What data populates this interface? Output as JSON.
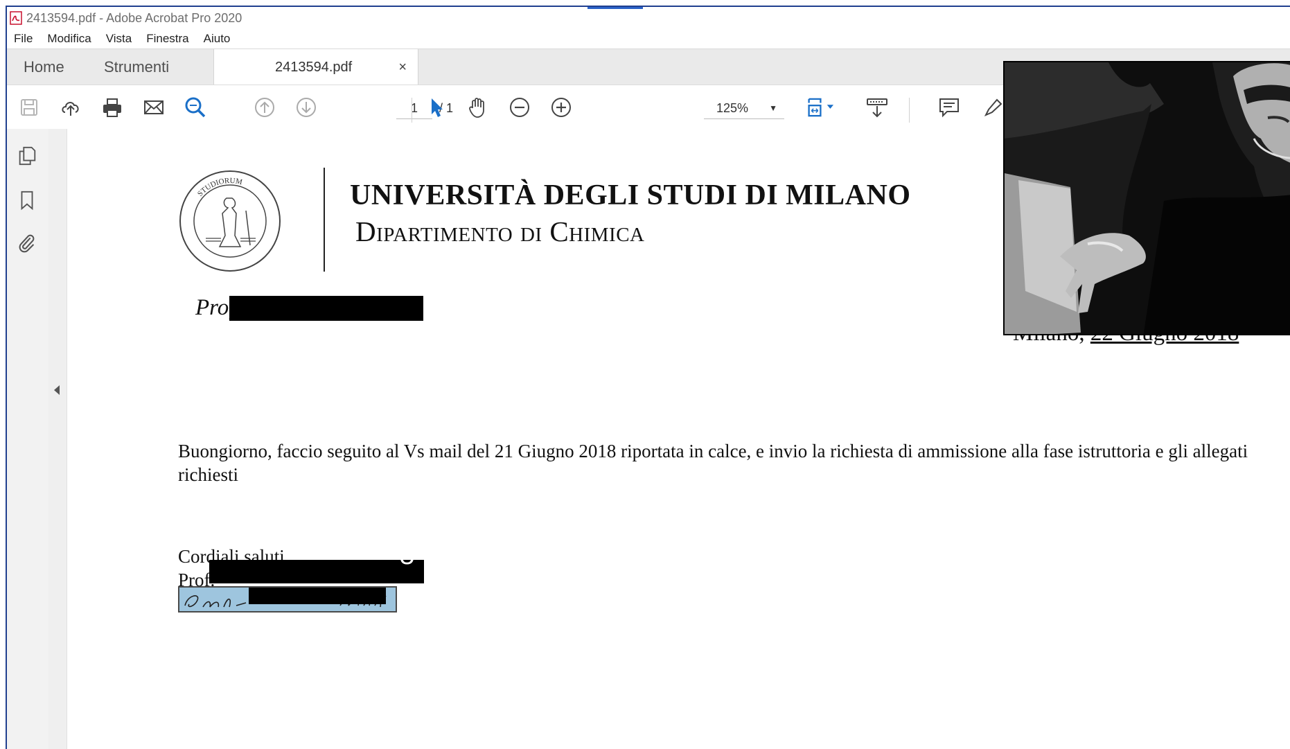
{
  "window": {
    "title": "2413594.pdf - Adobe Acrobat Pro 2020"
  },
  "menu": {
    "items": [
      "File",
      "Modifica",
      "Vista",
      "Finestra",
      "Aiuto"
    ]
  },
  "tabs": {
    "home": "Home",
    "tools": "Strumenti",
    "document": "2413594.pdf",
    "close": "×"
  },
  "toolbar": {
    "page_current": "1",
    "page_total": "/ 1",
    "zoom": "125%",
    "icons": [
      "save-icon",
      "upload-cloud-icon",
      "print-icon",
      "email-icon",
      "search-zoom-icon",
      "prev-page-icon",
      "next-page-icon",
      "select-arrow-icon",
      "hand-icon",
      "zoom-out-icon",
      "zoom-in-icon",
      "fit-page-icon",
      "scroll-mode-icon",
      "comment-icon",
      "highlight-pen-icon"
    ]
  },
  "sidebar": {
    "icons": [
      "pages-icon",
      "bookmark-icon",
      "attachment-icon"
    ]
  },
  "document": {
    "seal_text_top": "STUDIORUM",
    "university": "UNIVERSITÀ DEGLI STUDI DI MILANO",
    "department": "Dipartimento di Chimica",
    "prof_label": "Prof.",
    "date_city": "Milano, ",
    "date_value": "22 Giugno 2018",
    "body": "Buongiorno, faccio seguito al Vs mail del 21 Giugno 2018 riportata in calce, e invio la richiesta di ammissione alla fase istruttoria e gli allegati richiesti",
    "closing": "Cordiali saluti",
    "signature_prof": "Prof.",
    "stray_glyph": "Ù"
  },
  "colors": {
    "accent": "#2b62c8",
    "toolbar_blue": "#1a6fc8",
    "signature_bg": "#9ec5de"
  }
}
